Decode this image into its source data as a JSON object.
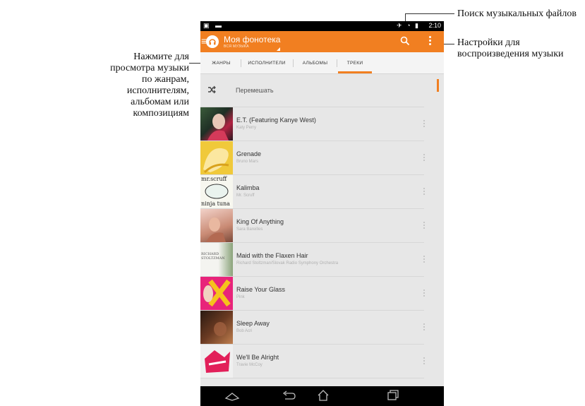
{
  "annotations": {
    "search_callout": "Поиск музыкальных файлов",
    "settings_callout": "Настройки для воспроизведения музыки",
    "browse_callout": "Нажмите для просмотра музыки по жанрам, исполнителям, альбомам или композициям"
  },
  "status_bar": {
    "time": "2:10"
  },
  "action_bar": {
    "title": "Моя фонотека",
    "subtitle": "ВСЯ МУЗЫКА"
  },
  "tabs": [
    {
      "label": "ЖАНРЫ",
      "active": false
    },
    {
      "label": "ИСПОЛНИТЕЛИ",
      "active": false
    },
    {
      "label": "АЛЬБОМЫ",
      "active": false
    },
    {
      "label": "ТРЕКИ",
      "active": true
    }
  ],
  "shuffle": {
    "label": "Перемешать"
  },
  "tracks": [
    {
      "title": "E.T. (Featuring Kanye West)",
      "artist": "Katy Perry"
    },
    {
      "title": "Grenade",
      "artist": "Bruno Mars"
    },
    {
      "title": "Kalimba",
      "artist": "Mr. Scruff"
    },
    {
      "title": "King Of Anything",
      "artist": "Sara Bareilles"
    },
    {
      "title": "Maid with the Flaxen Hair",
      "artist": "Richard Stoltzman/Slovak Radio Symphony Orchestra"
    },
    {
      "title": "Raise Your Glass",
      "artist": "Pink"
    },
    {
      "title": "Sleep Away",
      "artist": "Bob Acri"
    },
    {
      "title": "We'll Be Alright",
      "artist": "Travie McCoy"
    }
  ],
  "cover_art": {
    "kalimba_line1": "mr.scruff",
    "kalimba_line2": "ninja tuna",
    "maid_line1": "RICHARD",
    "maid_line2": "STOLTZMAN"
  },
  "colors": {
    "accent": "#f17f21",
    "background": "#e7e7e7",
    "callout_box": "#1f3f7a"
  }
}
